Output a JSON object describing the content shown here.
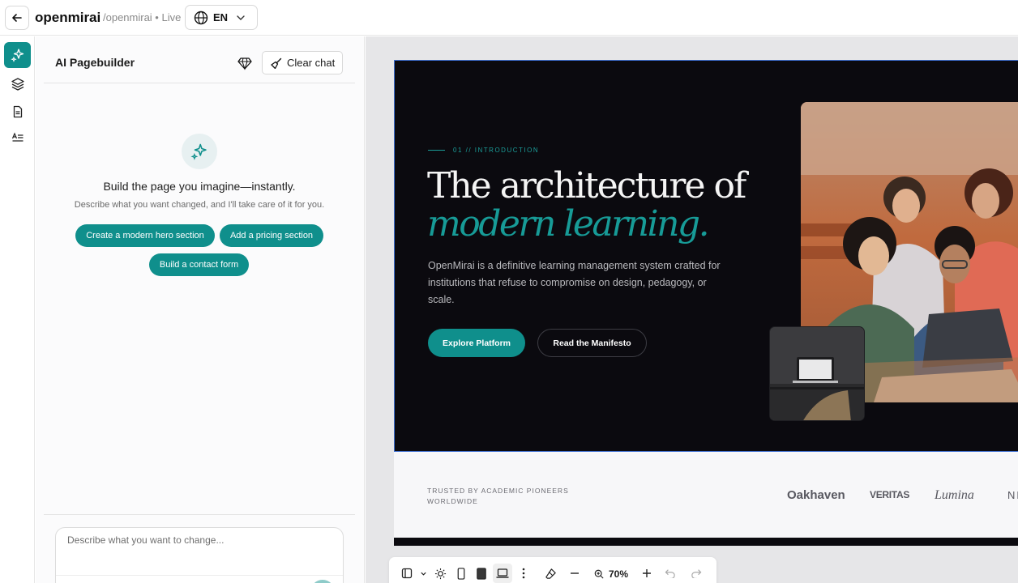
{
  "topbar": {
    "app_name": "openmirai",
    "path_status": "/openmirai • Live",
    "language": "EN"
  },
  "panel": {
    "title": "AI Pagebuilder",
    "clear_chat_label": "Clear chat",
    "empty_title": "Build the page you imagine—instantly.",
    "empty_subtitle": "Describe what you want changed, and I'll take care of it for you.",
    "suggestions": [
      "Create a modern hero section",
      "Add a pricing section",
      "Build a contact form"
    ],
    "prompt_placeholder": "Describe what you want to change..."
  },
  "preview": {
    "eyebrow": "01 // INTRODUCTION",
    "headline_line1": "The architecture of",
    "headline_line2": "modern learning.",
    "body": "OpenMirai is a definitive learning management system crafted for institutions that refuse to compromise on design, pedagogy, or scale.",
    "primary_cta": "Explore Platform",
    "secondary_cta": "Read the Manifesto",
    "trusted_label": "TRUSTED BY ACADEMIC PIONEERS WORLDWIDE",
    "logos": [
      "Oakhaven",
      "VERITAS",
      "Lumina",
      "NE"
    ]
  },
  "toolbar": {
    "zoom": "70%"
  },
  "colors": {
    "accent": "#0f8f8c",
    "hero_bg": "#0b0a0f",
    "canvas_bg": "#e6e6e8"
  }
}
